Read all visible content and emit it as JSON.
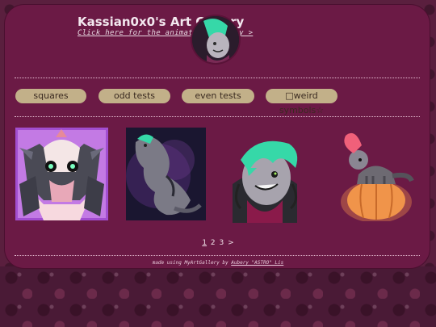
{
  "header": {
    "title": "Kassian0x0's Art Gallery",
    "anim_link": "Click here for the animation gallery >"
  },
  "tags": [
    {
      "label": "squares"
    },
    {
      "label": "odd tests"
    },
    {
      "label": "even tests"
    },
    {
      "label": "□weird symbols☆"
    }
  ],
  "gallery": [
    {
      "name": "dragon-mask-square"
    },
    {
      "name": "dragon-dark-square"
    },
    {
      "name": "green-hair-bust"
    },
    {
      "name": "creature-on-pumpkin"
    }
  ],
  "pager": {
    "current": "1",
    "pages": [
      "2",
      "3"
    ],
    "next": ">"
  },
  "footer": {
    "made_using": "made using MyArtGallery by",
    "author": "Aubery \"ASTRO\" Lis"
  },
  "colors": {
    "panel": "#6b1a45",
    "tag": "#c2b089",
    "accent_green": "#3ee0b0"
  }
}
